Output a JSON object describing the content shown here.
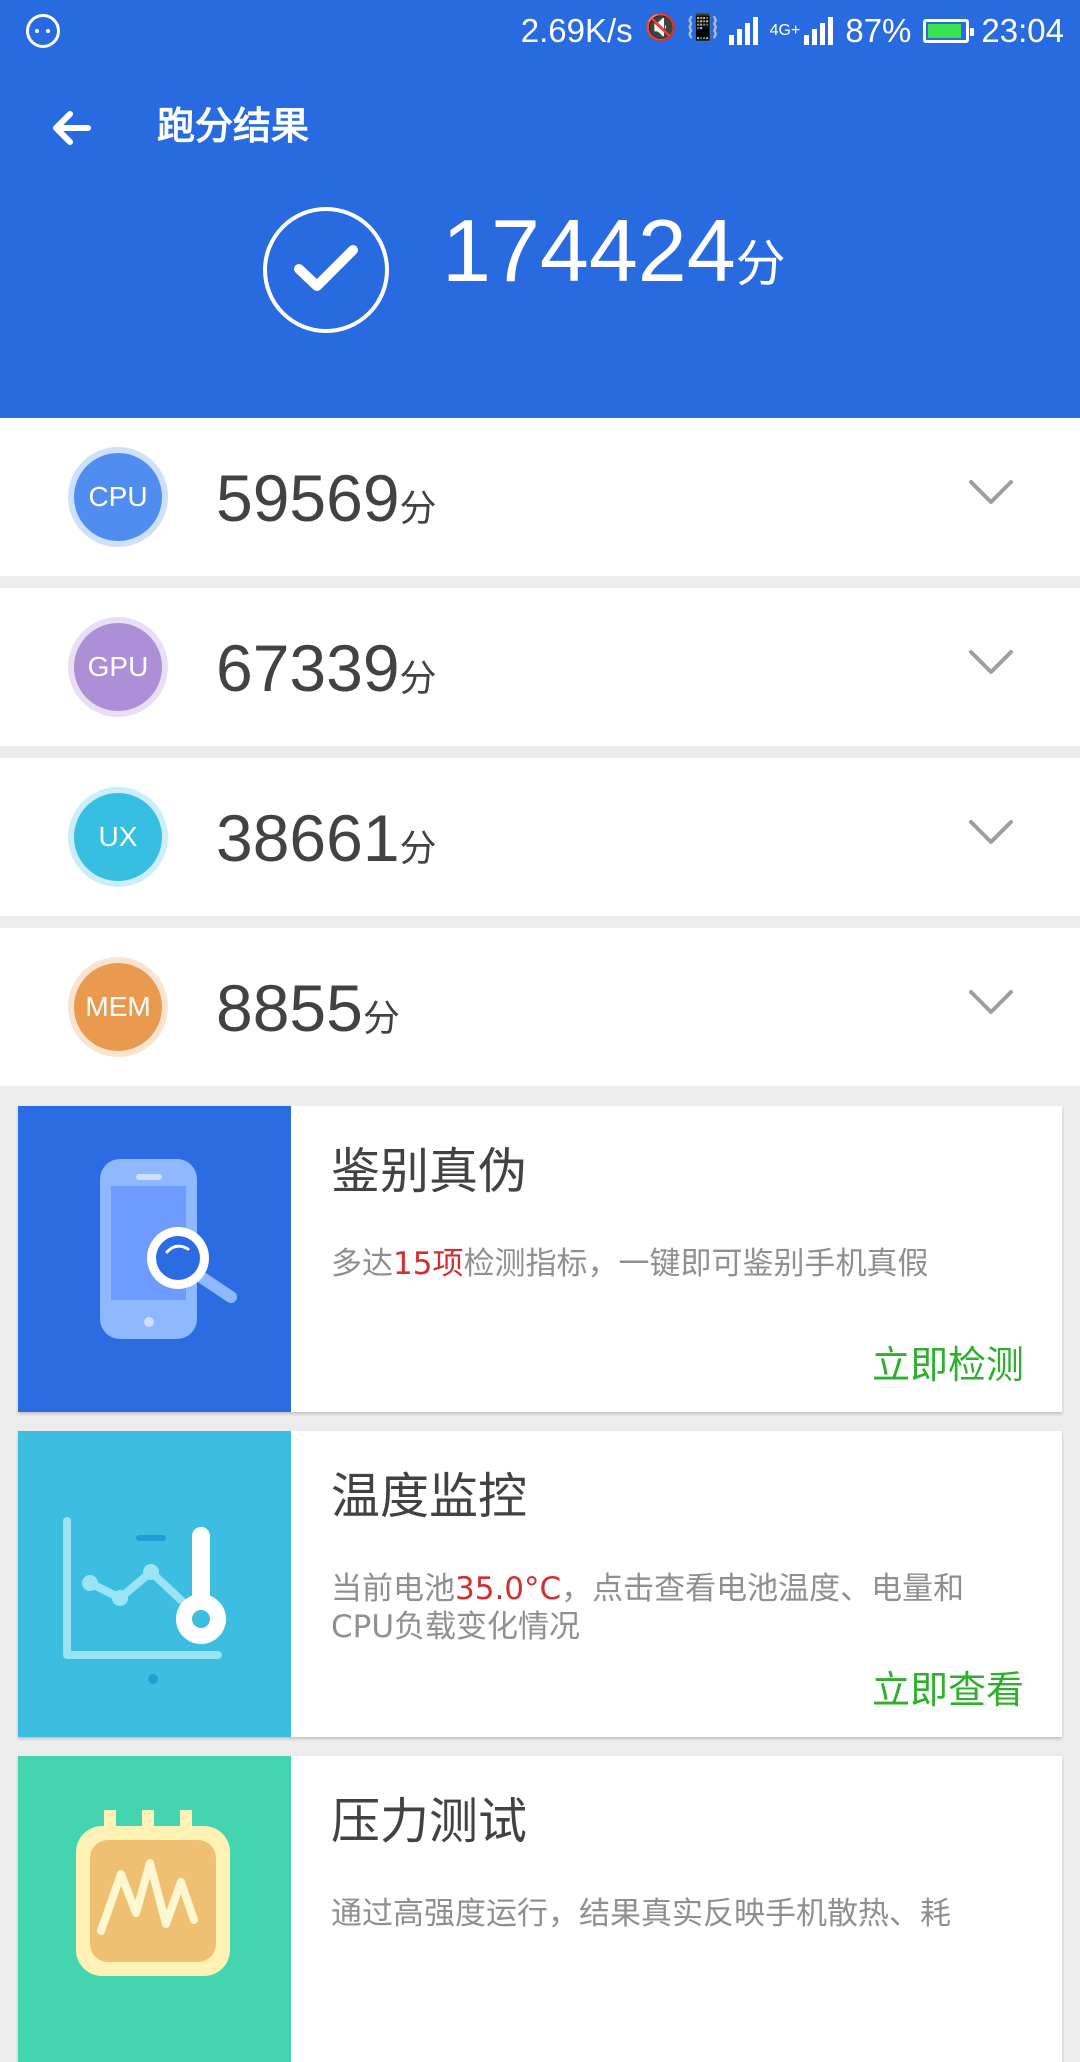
{
  "status_bar": {
    "network_speed": "2.69K/s",
    "network_type": "4G+",
    "battery_percent": "87%",
    "time": "23:04"
  },
  "header": {
    "title": "跑分结果",
    "total_score": "174424",
    "score_unit": "分"
  },
  "scores": [
    {
      "label": "CPU",
      "value": "59569",
      "unit": "分",
      "color": "#4f8ef0",
      "ring": "#cfe0fa"
    },
    {
      "label": "GPU",
      "value": "67339",
      "unit": "分",
      "color": "#ac8fd7",
      "ring": "#e8def6"
    },
    {
      "label": "UX",
      "value": "38661",
      "unit": "分",
      "color": "#36bfe2",
      "ring": "#cbeef8"
    },
    {
      "label": "MEM",
      "value": "8855",
      "unit": "分",
      "color": "#e99a4e",
      "ring": "#fae4cf"
    }
  ],
  "cards": [
    {
      "title": "鉴别真伪",
      "desc_prefix": "多达",
      "desc_highlight": "15项",
      "desc_suffix": "检测指标，一键即可鉴别手机真假",
      "action": "立即检测",
      "panel_color": "#2b6ce2"
    },
    {
      "title": "温度监控",
      "desc_prefix": "当前电池",
      "desc_highlight": "35.0°C",
      "desc_suffix": "，点击查看电池温度、电量和CPU负载变化情况",
      "action": "立即查看",
      "panel_color": "#3cbde2"
    },
    {
      "title": "压力测试",
      "desc_prefix": "通过高强度运行，结果真实反映手机散热、耗",
      "desc_highlight": "",
      "desc_suffix": "",
      "action": "",
      "panel_color": "#43d4b0"
    }
  ],
  "colors": {
    "accent": "#286be0",
    "action_green": "#2eaf2e",
    "highlight_red": "#d32f2f"
  }
}
